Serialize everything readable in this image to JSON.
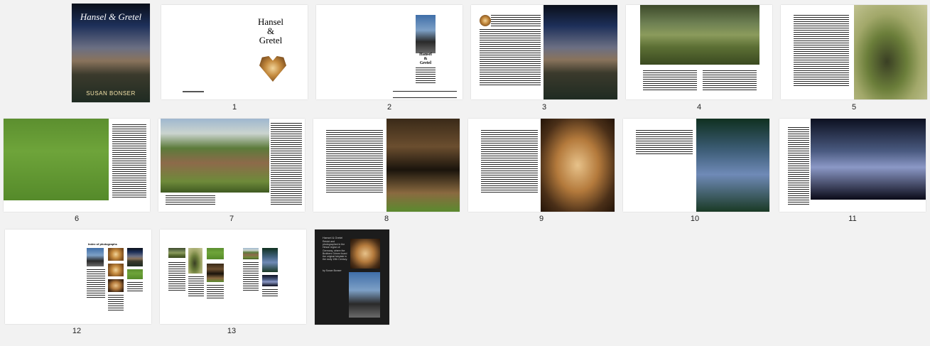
{
  "cover": {
    "title": "Hansel & Gretel",
    "author": "SUSAN BONSER"
  },
  "title_page": {
    "title_line1": "Hansel",
    "title_line2": "&",
    "title_line3": "Gretel"
  },
  "page2": {
    "title_line1": "Hansel",
    "title_line2": "&",
    "title_line3": "Gretel"
  },
  "page12": {
    "heading": "Index of photographs"
  },
  "back_cover": {
    "title": "Hansel & Gretel",
    "blurb": "Retold and photographed in the Hesse region of Germany, where the Brothers Grimm found the original fairytale in the early 19th Century.",
    "byline": "by Susan Bonser"
  },
  "page_numbers": [
    "1",
    "2",
    "3",
    "4",
    "5",
    "6",
    "7",
    "8",
    "9",
    "10",
    "11",
    "12",
    "13"
  ],
  "colors": {
    "background": "#f2f2f2",
    "page": "#ffffff",
    "back_cover": "#1c1c1c"
  }
}
